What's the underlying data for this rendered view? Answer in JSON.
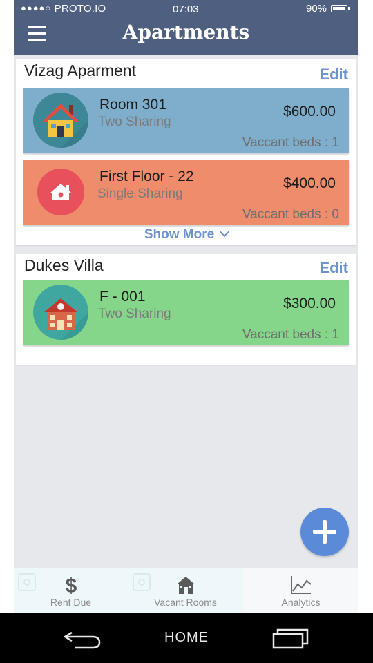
{
  "status_bar": {
    "signal_dots": "●●●●○",
    "carrier": "PROTO.IO",
    "time": "07:03",
    "battery": "90%",
    "battery_level": 0.9
  },
  "header": {
    "title": "Apartments",
    "menu_icon": "hamburger-menu-icon",
    "background": "#4f5f7f"
  },
  "apartments": [
    {
      "name": "Vizag Aparment",
      "edit_label": "Edit",
      "rooms": [
        {
          "name": "Room 301",
          "type": "Two Sharing",
          "price": "$600.00",
          "vacancy": "Vaccant beds : 1",
          "color": "#7faecd",
          "icon": "house-icon"
        },
        {
          "name": "First Floor - 22",
          "type": "Single Sharing",
          "price": "$400.00",
          "vacancy": "Vaccant beds : 0",
          "color": "#ef8c6c",
          "icon": "home-circle-icon"
        }
      ],
      "show_more_label": "Show More"
    },
    {
      "name": "Dukes Villa",
      "edit_label": "Edit",
      "rooms": [
        {
          "name": "F - 001",
          "type": "Two Sharing",
          "price": "$300.00",
          "vacancy": "Vaccant beds : 1",
          "color": "#85d68a",
          "icon": "building-icon"
        }
      ]
    }
  ],
  "fab": {
    "icon": "plus-icon",
    "color": "#5b8bd8"
  },
  "tabs": [
    {
      "label": "Rent Due",
      "icon": "dollar-icon"
    },
    {
      "label": "Vacant Rooms",
      "icon": "house-tab-icon"
    },
    {
      "label": "Analytics",
      "icon": "line-chart-icon"
    }
  ],
  "system_nav": {
    "home_label": "HOME",
    "back_icon": "back-arrow-icon",
    "recent_icon": "recent-apps-icon"
  },
  "accent_color": "#6d93cf"
}
